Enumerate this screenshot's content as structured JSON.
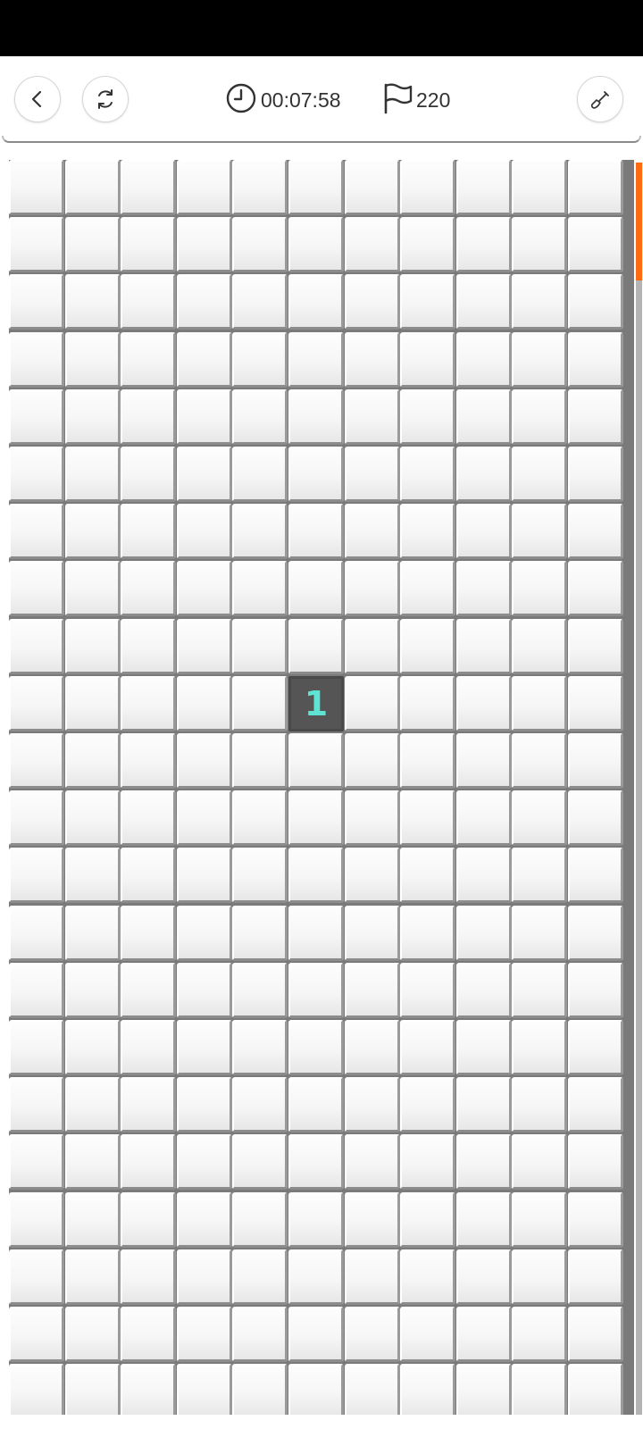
{
  "header": {
    "timer": "00:07:58",
    "flags": "220",
    "icons": {
      "back": "chevron-left-icon",
      "restart": "refresh-icon",
      "clock": "clock-icon",
      "flag": "flag-icon",
      "tool": "shovel-icon"
    }
  },
  "board": {
    "columns": 11,
    "visible_rows": 22,
    "revealed": [
      {
        "row": 9,
        "col": 5,
        "value": "1"
      }
    ],
    "number_color": "#5fe3d3"
  },
  "scrollbar": {
    "thumb_color": "#ff6a13",
    "position_fraction": 0
  }
}
